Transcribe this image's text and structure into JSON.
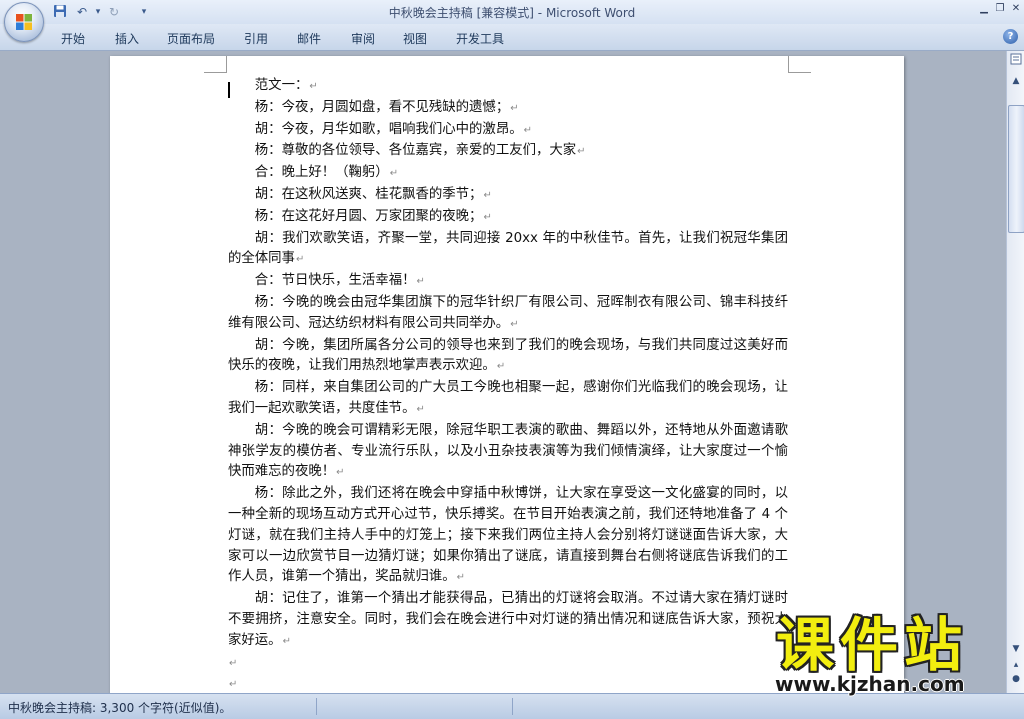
{
  "window": {
    "title": "中秋晚会主持稿 [兼容模式]",
    "separator": " - ",
    "app_name": "Microsoft Word"
  },
  "quick_access": {
    "save_icon": "save-icon",
    "undo_icon": "undo-icon",
    "redo_icon": "redo-icon",
    "customize_icon": "customize-qat-icon"
  },
  "ribbon": {
    "tabs": [
      "开始",
      "插入",
      "页面布局",
      "引用",
      "邮件",
      "审阅",
      "视图",
      "开发工具"
    ]
  },
  "document": {
    "paragraphs": [
      "范文一：",
      "杨：今夜，月圆如盘，看不见残缺的遗憾；",
      "胡：今夜，月华如歌，唱响我们心中的激昂。",
      "杨：尊敬的各位领导、各位嘉宾，亲爱的工友们，大家",
      "合：晚上好！（鞠躬）",
      "胡：在这秋风送爽、桂花飘香的季节；",
      "杨：在这花好月圆、万家团聚的夜晚；",
      "胡：我们欢歌笑语，齐聚一堂，共同迎接 20xx 年的中秋佳节。首先，让我们祝冠华集团的全体同事",
      "合：节日快乐，生活幸福！",
      "杨：今晚的晚会由冠华集团旗下的冠华针织厂有限公司、冠晖制衣有限公司、锦丰科技纤维有限公司、冠达纺织材料有限公司共同举办。",
      "胡：今晚，集团所属各分公司的领导也来到了我们的晚会现场，与我们共同度过这美好而快乐的夜晚，让我们用热烈地掌声表示欢迎。",
      "杨：同样，来自集团公司的广大员工今晚也相聚一起，感谢你们光临我们的晚会现场，让我们一起欢歌笑语，共度佳节。",
      "胡：今晚的晚会可谓精彩无限，除冠华职工表演的歌曲、舞蹈以外，还特地从外面邀请歌神张学友的模仿者、专业流行乐队，以及小丑杂技表演等为我们倾情演绎，让大家度过一个愉快而难忘的夜晚！",
      "杨：除此之外，我们还将在晚会中穿插中秋博饼，让大家在享受这一文化盛宴的同时，以一种全新的现场互动方式开心过节，快乐搏奖。在节目开始表演之前，我们还特地准备了 4 个灯谜，就在我们主持人手中的灯笼上；接下来我们两位主持人会分别将灯谜谜面告诉大家，大家可以一边欣赏节目一边猜灯谜；如果你猜出了谜底，请直接到舞台右侧将谜底告诉我们的工作人员，谁第一个猜出，奖品就归谁。",
      "胡：记住了，谁第一个猜出才能获得品，已猜出的灯谜将会取消。不过请大家在猜灯谜时不要拥挤，注意安全。同时，我们会在晚会进行中对灯谜的猜出情况和谜底告诉大家，预祝大家好运。",
      "",
      "",
      ""
    ],
    "paragraph_mark": "↵"
  },
  "statusbar": {
    "text": "中秋晚会主持稿: 3,300 个字符(近似值)。"
  },
  "watermark": {
    "title": "课件站",
    "url": "www.kjzhan.com"
  },
  "colors": {
    "title_accent": "#3e4f70",
    "watermark_yellow": "#f2ee0f",
    "workspace": "#a9b3c2"
  }
}
